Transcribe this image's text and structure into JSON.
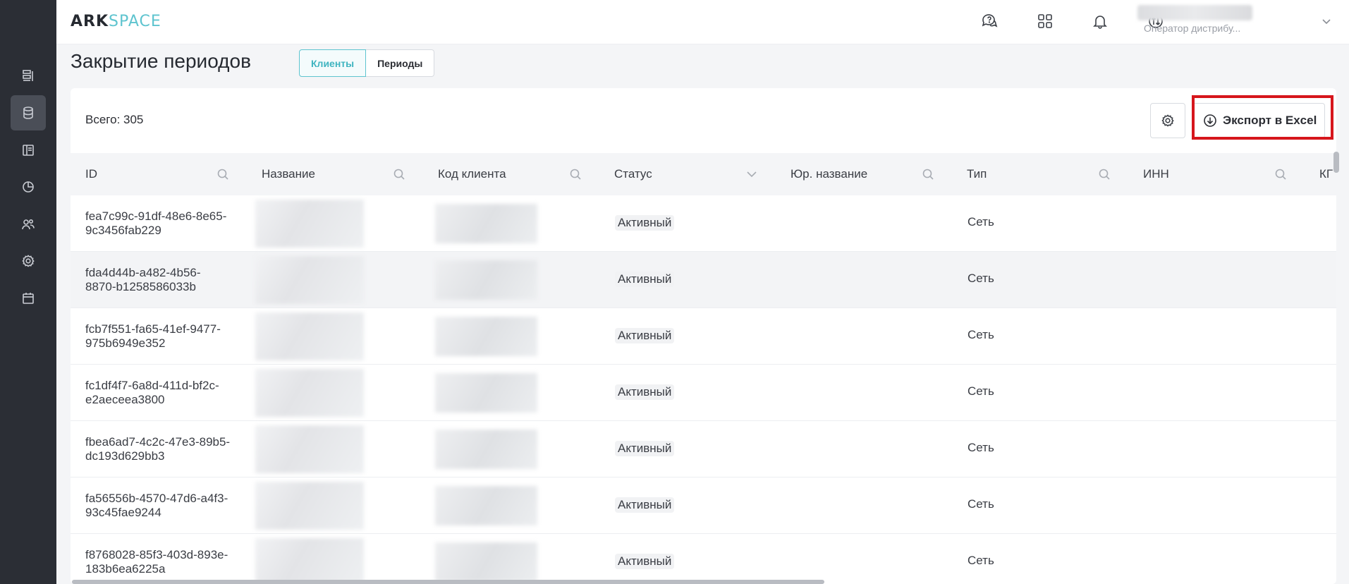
{
  "logo": {
    "part1": "ARK",
    "part2": "SPACE"
  },
  "header": {
    "user_role": "Оператор дистрибу..."
  },
  "page": {
    "title": "Закрытие периодов",
    "tabs": [
      {
        "label": "Клиенты",
        "active": true
      },
      {
        "label": "Периоды",
        "active": false
      }
    ]
  },
  "toolbar": {
    "total": "Всего: 305",
    "export_label": "Экспорт в Excel"
  },
  "table": {
    "columns": [
      {
        "label": "ID",
        "icon": "search-icon"
      },
      {
        "label": "Название",
        "icon": "search-icon"
      },
      {
        "label": "Код клиента",
        "icon": "search-icon"
      },
      {
        "label": "Статус",
        "icon": "chevron-down-icon"
      },
      {
        "label": "Юр. название",
        "icon": "search-icon"
      },
      {
        "label": "Тип",
        "icon": "search-icon"
      },
      {
        "label": "ИНН",
        "icon": "search-icon"
      },
      {
        "label": "КГ",
        "icon": ""
      }
    ],
    "rows": [
      {
        "id_line1": "fea7c99c-91df-48e6-8e65-",
        "id_line2": "9c3456fab229",
        "status": "Активный",
        "type": "Сеть"
      },
      {
        "id_line1": "fda4d44b-a482-4b56-",
        "id_line2": "8870-b1258586033b",
        "status": "Активный",
        "type": "Сеть"
      },
      {
        "id_line1": "fcb7f551-fa65-41ef-9477-",
        "id_line2": "975b6949e352",
        "status": "Активный",
        "type": "Сеть"
      },
      {
        "id_line1": "fc1df4f7-6a8d-411d-bf2c-",
        "id_line2": "e2aeceea3800",
        "status": "Активный",
        "type": "Сеть"
      },
      {
        "id_line1": "fbea6ad7-4c2c-47e3-89b5-",
        "id_line2": "dc193d629bb3",
        "status": "Активный",
        "type": "Сеть"
      },
      {
        "id_line1": "fa56556b-4570-47d6-a4f3-",
        "id_line2": "93c45fae9244",
        "status": "Активный",
        "type": "Сеть"
      },
      {
        "id_line1": "f8768028-85f3-403d-893e-",
        "id_line2": "183b6ea6225a",
        "status": "Активный",
        "type": "Сеть"
      }
    ]
  },
  "colors": {
    "accent": "#5ec4cf",
    "highlight": "#d6161c",
    "rail": "#2b2e35"
  }
}
